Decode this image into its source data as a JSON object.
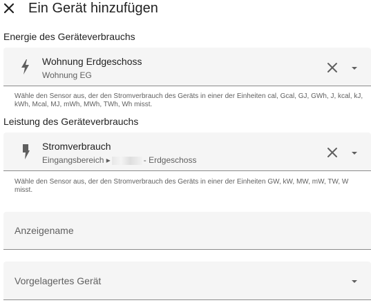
{
  "dialog": {
    "title": "Ein Gerät hinzufügen"
  },
  "energy": {
    "section_label": "Energie des Geräteverbrauchs",
    "sensor_name": "Wohnung Erdgeschoss",
    "sensor_area": "Wohnung EG",
    "helper_text": "Wähle den Sensor aus, der den Stromverbrauch des Geräts in einer der Einheiten cal, Gcal, GJ, GWh, J, kcal, kJ, kWh, Mcal, MJ, mWh, MWh, TWh, Wh misst.",
    "icon": "lightning-bolt-icon"
  },
  "power": {
    "section_label": "Leistung des Geräteverbrauchs",
    "sensor_name": "Stromverbrauch",
    "sensor_path_prefix": "Eingangsbereich ▸",
    "sensor_path_suffix": "- Erdgeschoss",
    "helper_text": "Wähle den Sensor aus, der den Stromverbrauch des Geräts in einer der Einheiten GW, kW, MW, mW, TW, W misst.",
    "icon": "flash-icon"
  },
  "display_name": {
    "placeholder": "Anzeigename",
    "value": ""
  },
  "upstream_device": {
    "label": "Vorgelagertes Gerät"
  }
}
